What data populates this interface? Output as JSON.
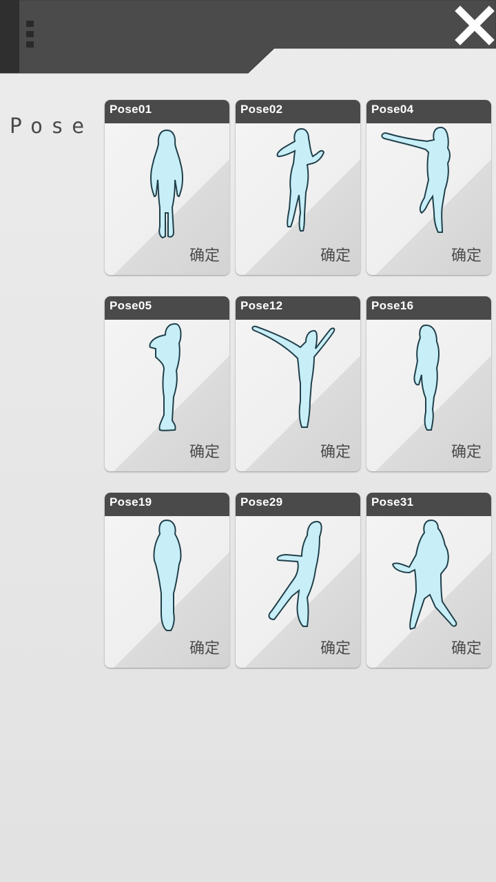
{
  "header": {
    "menu_icon": "menu-handle-icon",
    "close_icon": "close-icon",
    "colors": {
      "bar": "#4b4b4b",
      "close": "#ffffff"
    }
  },
  "section": {
    "label": "Pose"
  },
  "poses": [
    {
      "name": "Pose01",
      "confirm_label": "确定",
      "silhouette": "standing-arms-down"
    },
    {
      "name": "Pose02",
      "confirm_label": "确定",
      "silhouette": "hand-on-chin"
    },
    {
      "name": "Pose04",
      "confirm_label": "确定",
      "silhouette": "arm-extended-pointing"
    },
    {
      "name": "Pose05",
      "confirm_label": "确定",
      "silhouette": "side-turned"
    },
    {
      "name": "Pose12",
      "confirm_label": "确定",
      "silhouette": "arms-raised-v"
    },
    {
      "name": "Pose16",
      "confirm_label": "确定",
      "silhouette": "hand-on-hip"
    },
    {
      "name": "Pose19",
      "confirm_label": "确定",
      "silhouette": "hands-behind-back"
    },
    {
      "name": "Pose29",
      "confirm_label": "确定",
      "silhouette": "seated-crossed-legs"
    },
    {
      "name": "Pose31",
      "confirm_label": "确定",
      "silhouette": "wide-stance-tail"
    }
  ],
  "colors": {
    "silhouette_fill": "#c8eef8",
    "silhouette_stroke": "#1f3f4a",
    "card_header": "#4a4a4a"
  }
}
